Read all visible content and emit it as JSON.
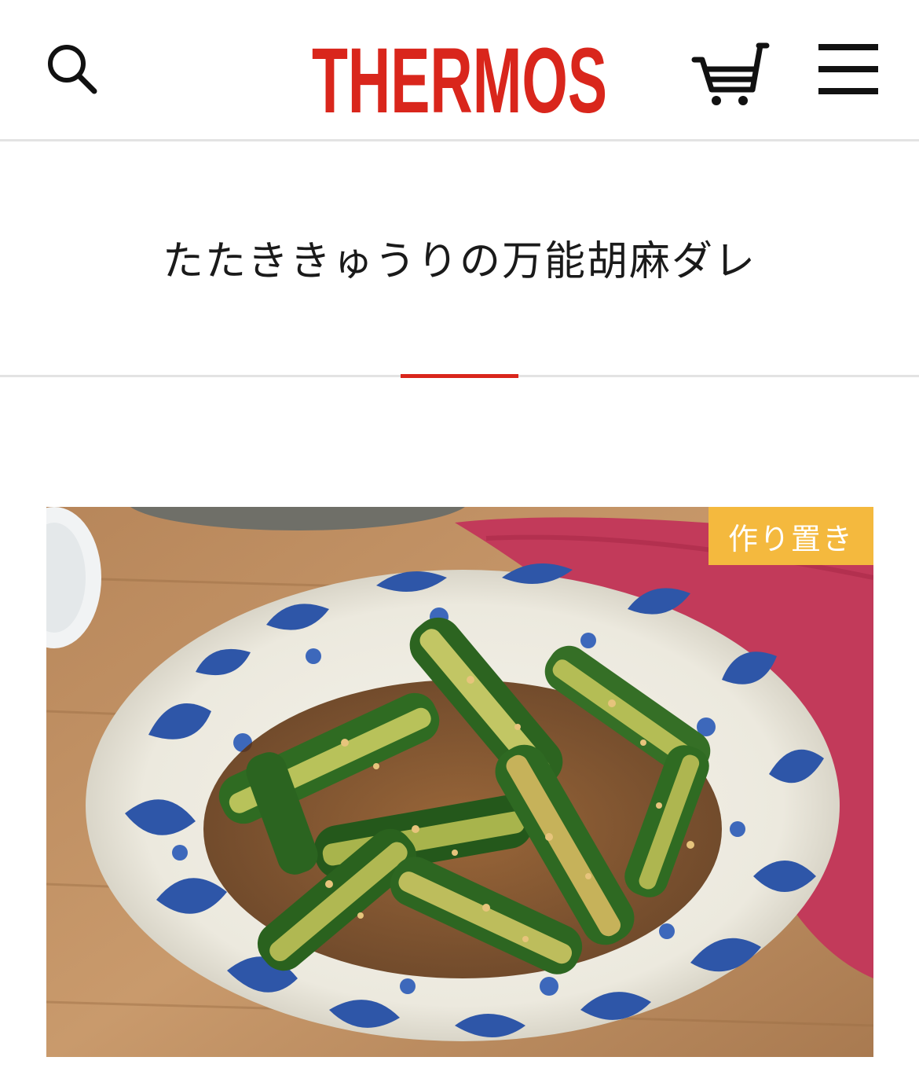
{
  "header": {
    "brand": "THERMOS",
    "brand_color": "#d9261c",
    "icons": {
      "search": "search-icon",
      "cart": "cart-icon",
      "menu": "hamburger-menu-icon"
    }
  },
  "recipe": {
    "title": "たたききゅうりの万能胡麻ダレ",
    "category_badge": "作り置き",
    "badge_color": "#f4b93e",
    "accent_color": "#d9261c"
  }
}
